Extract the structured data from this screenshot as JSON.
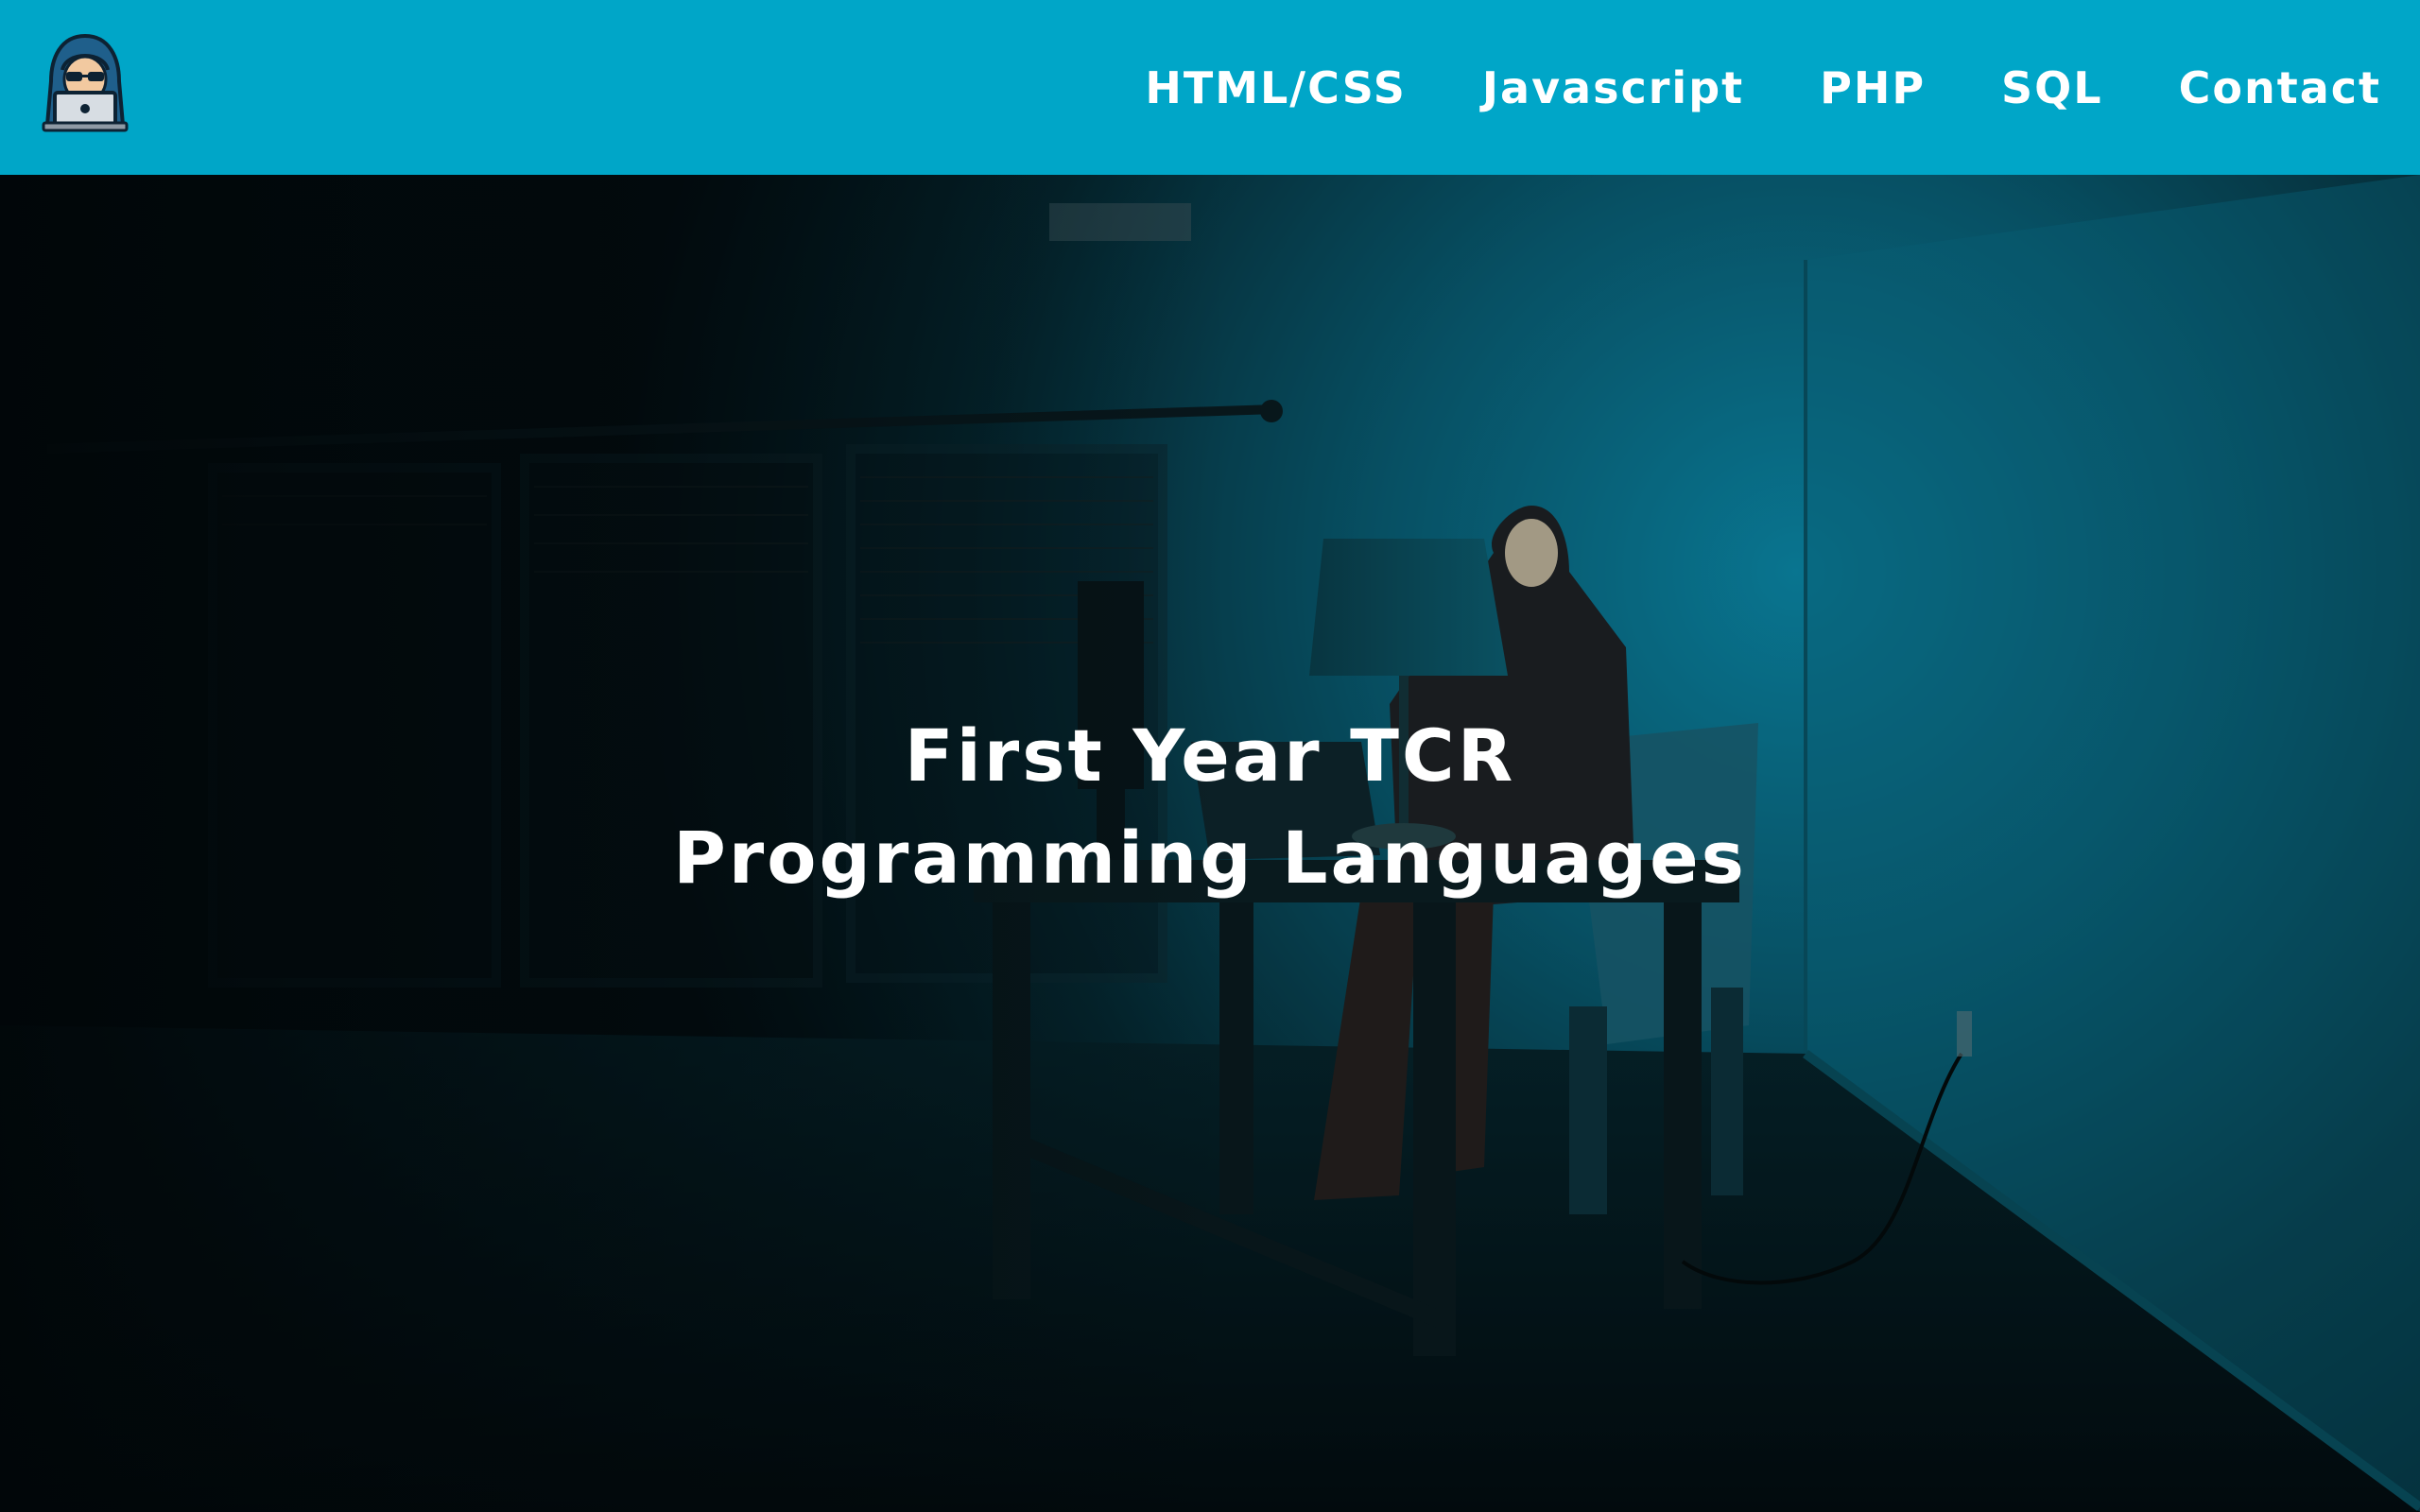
{
  "header": {
    "logo_icon": "hacker-hoodie-laptop-icon",
    "background_color": "#00a6c8",
    "nav": [
      {
        "label": "HTML/CSS"
      },
      {
        "label": "Javascript"
      },
      {
        "label": "PHP"
      },
      {
        "label": "SQL"
      },
      {
        "label": "Contact"
      }
    ]
  },
  "hero": {
    "image": "hooded-figure-at-desk-in-dark-blue-room",
    "title_line1": "First Year TCR",
    "title_line2": "Programming Languages"
  }
}
